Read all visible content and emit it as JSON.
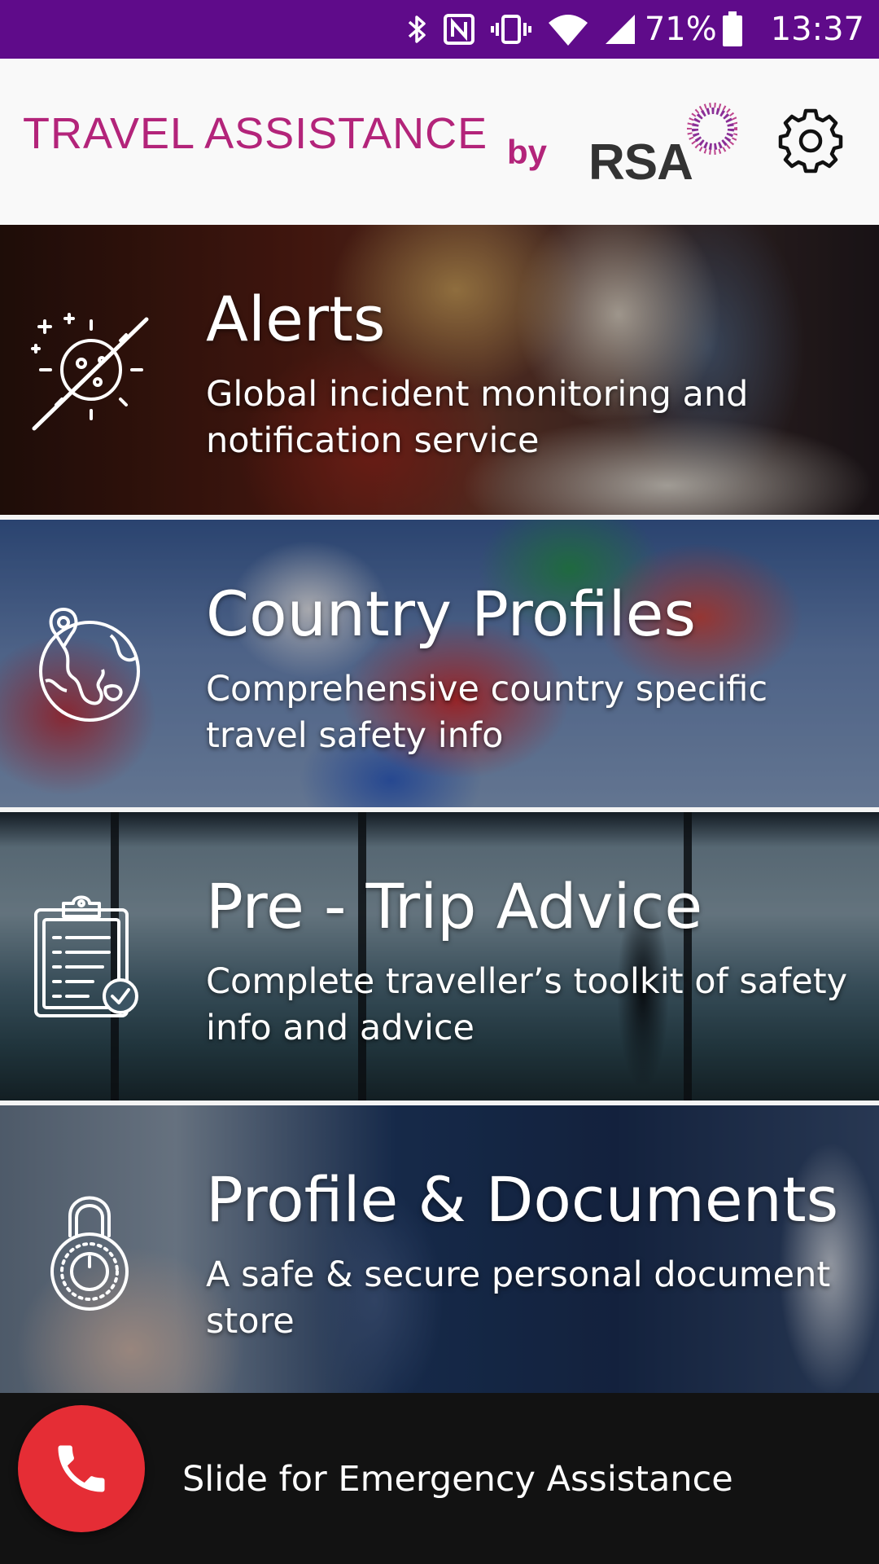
{
  "status_bar": {
    "battery_percent": "71%",
    "time": "13:37",
    "icons": [
      "bluetooth-icon",
      "nfc-icon",
      "vibrate-icon",
      "wifi-icon",
      "signal-icon",
      "battery-icon"
    ]
  },
  "header": {
    "title": "TRAVEL ASSISTANCE",
    "by": "by",
    "logo_text": "RSA",
    "settings_icon": "gear-icon"
  },
  "colors": {
    "status_bar": "#5f0b8a",
    "brand_pink": "#b3247a",
    "emergency_red": "#e52d35"
  },
  "menu": {
    "items": [
      {
        "title": "Alerts",
        "description": "Global incident monitoring and notification service",
        "icon": "alert-sun-icon"
      },
      {
        "title": "Country Profiles",
        "description": "Comprehensive country specific travel safety info",
        "icon": "globe-pin-icon"
      },
      {
        "title": "Pre - Trip Advice",
        "description": "Complete traveller’s toolkit of safety info and advice",
        "icon": "clipboard-check-icon"
      },
      {
        "title": "Profile & Documents",
        "description": "A safe & secure personal document store",
        "icon": "padlock-icon"
      }
    ]
  },
  "emergency": {
    "label": "Slide for Emergency Assistance",
    "icon": "phone-icon"
  }
}
